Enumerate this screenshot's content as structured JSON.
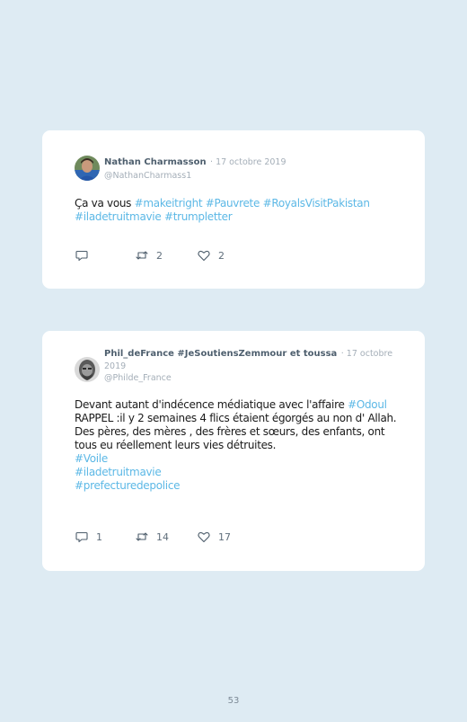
{
  "tweets": [
    {
      "name": "Nathan Charmasson",
      "date": "· 17 octobre 2019",
      "handle": "@NathanCharmass1",
      "text_intro": "Ça va vous ",
      "tags": [
        "#makeitright",
        "#Pauvrete",
        "#RoyalsVisitPakistan",
        "#iladetruitmavie",
        "#trumpletter"
      ],
      "reply_count": "",
      "retweet_count": "2",
      "like_count": "2"
    },
    {
      "name": "Phil_deFrance #JeSoutiensZemmour et toussa",
      "date": "· 17 octobre 2019",
      "handle": "@Philde_France",
      "text_before_tag": "Devant autant d'indécence médiatique avec l'affaire ",
      "inline_tag": "#Odoul",
      "text_line_2": "RAPPEL :il y 2 semaines 4 flics étaient égorgés au non d' Allah.",
      "text_line_3": "Des pères, des mères , des frères et sœurs, des enfants, ont tous eu réellement leurs vies détruites.",
      "tags": [
        "#Voile",
        "#iladetruitmavie",
        "#prefecturedepolice"
      ],
      "reply_count": "1",
      "retweet_count": "14",
      "like_count": "17"
    }
  ],
  "page_number": "53",
  "colors": {
    "background": "#deebf3",
    "card": "#ffffff",
    "hashtag": "#5cb8e6",
    "muted": "#a4aeb8",
    "name": "#4e5f6e"
  }
}
